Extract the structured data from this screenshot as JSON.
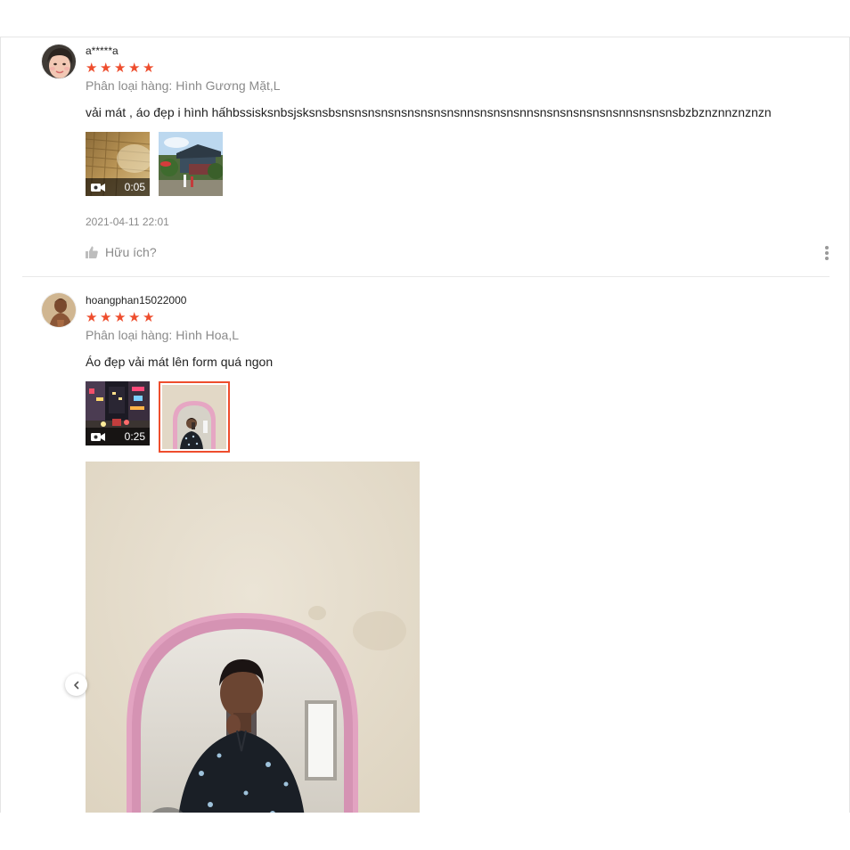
{
  "colors": {
    "accent": "#ee4d2d",
    "muted": "#8a8a8a",
    "text": "#222222"
  },
  "reviews": [
    {
      "author": "a*****a",
      "rating": 5,
      "variation": "Phân loại hàng: Hình Gương Mặt,L",
      "content": "vải mát , áo đẹp i hình hấhbssisksnbsjsksnsbsnsnsnsnsnsnsnsnsnsnnsnsnsnsnnsnsnsnsnsnsnsnnsnsnsnsbzbznznnznznzn",
      "media": [
        {
          "kind": "video",
          "duration": "0:05",
          "icon": "video-camera-icon"
        },
        {
          "kind": "image"
        }
      ],
      "date": "2021-04-11 22:01",
      "helpful_label": "Hữu ích?",
      "helpful_icon": "thumbs-up-icon"
    },
    {
      "author": "hoangphan15022000",
      "rating": 5,
      "variation": "Phân loại hàng: Hình Hoa,L",
      "content": "Áo đẹp vải mát lên form quá ngon",
      "media": [
        {
          "kind": "video",
          "duration": "0:25",
          "icon": "video-camera-icon"
        },
        {
          "kind": "image",
          "selected": true
        }
      ]
    }
  ],
  "viewer": {
    "prev_icon": "chevron-left-icon",
    "more_icon": "more-vertical-icon"
  }
}
